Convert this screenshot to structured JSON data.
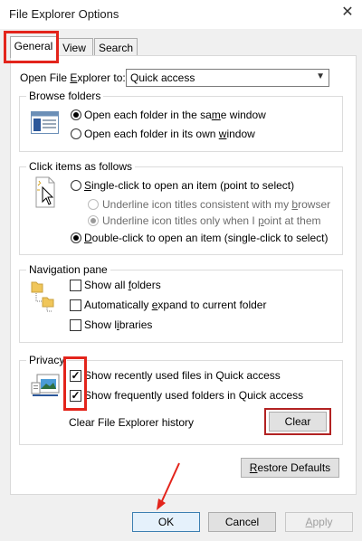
{
  "window": {
    "title": "File Explorer Options"
  },
  "tabs": [
    {
      "label": "General"
    },
    {
      "label": "View"
    },
    {
      "label": "Search"
    }
  ],
  "open_explorer": {
    "label": "Open File Explorer to:",
    "value": "Quick access"
  },
  "browse_folders": {
    "title": "Browse folders",
    "options": [
      {
        "label": "Open each folder in the same window",
        "checked": true
      },
      {
        "label": "Open each folder in its own window",
        "checked": false
      }
    ]
  },
  "click_items": {
    "title": "Click items as follows",
    "single_click": "Single-click to open an item (point to select)",
    "underline_browser": "Underline icon titles consistent with my browser",
    "underline_point": "Underline icon titles only when I point at them",
    "double_click": "Double-click to open an item (single-click to select)"
  },
  "navigation_pane": {
    "title": "Navigation pane",
    "options": [
      {
        "label": "Show all folders",
        "checked": false
      },
      {
        "label": "Automatically expand to current folder",
        "checked": false
      },
      {
        "label": "Show libraries",
        "checked": false
      }
    ]
  },
  "privacy": {
    "title": "Privacy",
    "options": [
      {
        "label": "Show recently used files in Quick access",
        "checked": true
      },
      {
        "label": "Show frequently used folders in Quick access",
        "checked": true
      }
    ],
    "clear_history_label": "Clear File Explorer history",
    "clear_button": "Clear"
  },
  "restore_defaults": "Restore Defaults",
  "footer": {
    "ok": "OK",
    "cancel": "Cancel",
    "apply": "Apply"
  },
  "colors": {
    "highlight": "#e3241b",
    "highlight_dark": "#b22222",
    "accent": "#3c7fb1"
  },
  "icons": {
    "close": "close-icon",
    "browse": "window-icon",
    "click": "pointer-icon",
    "nav": "folder-tree-icon",
    "privacy": "recent-files-icon"
  }
}
